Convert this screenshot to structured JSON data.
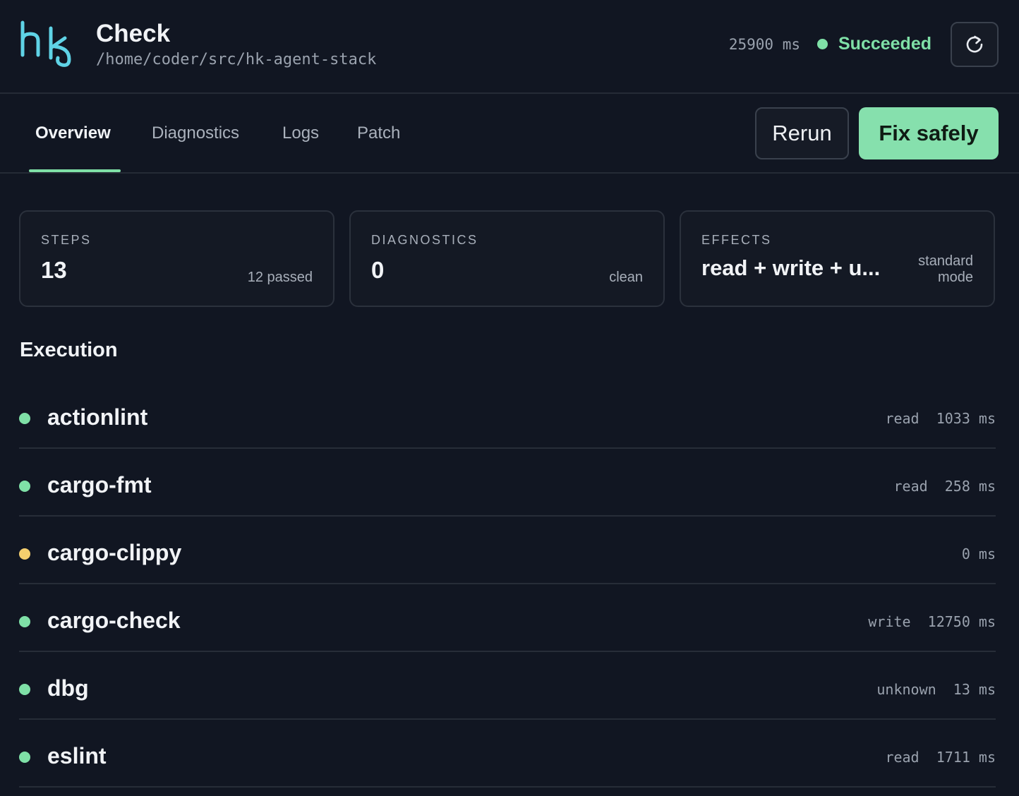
{
  "header": {
    "title": "Check",
    "path": "/home/coder/src/hk-agent-stack",
    "duration": "25900 ms",
    "status": "Succeeded",
    "status_color": "#7fe0a7",
    "refresh_icon": "refresh-icon"
  },
  "tabs": [
    {
      "label": "Overview",
      "active": true
    },
    {
      "label": "Diagnostics",
      "active": false
    },
    {
      "label": "Logs",
      "active": false
    },
    {
      "label": "Patch",
      "active": false
    }
  ],
  "actions": {
    "rerun_label": "Rerun",
    "fix_label": "Fix safely",
    "fix_color": "#86e0ad"
  },
  "cards": [
    {
      "label": "STEPS",
      "value": "13",
      "note": "12 passed"
    },
    {
      "label": "DIAGNOSTICS",
      "value": "0",
      "note": "clean"
    },
    {
      "label": "EFFECTS",
      "value": "read + write + u...",
      "note_line1": "standard",
      "note_line2": "mode"
    }
  ],
  "execution": {
    "title": "Execution",
    "steps": [
      {
        "name": "actionlint",
        "effect": "read",
        "time": "1033 ms",
        "status": "passed",
        "dot_color": "#7fe0a7"
      },
      {
        "name": "cargo-fmt",
        "effect": "read",
        "time": "258 ms",
        "status": "passed",
        "dot_color": "#7fe0a7"
      },
      {
        "name": "cargo-clippy",
        "effect": "",
        "time": "0 ms",
        "status": "pending",
        "dot_color": "#f5cf6e"
      },
      {
        "name": "cargo-check",
        "effect": "write",
        "time": "12750 ms",
        "status": "passed",
        "dot_color": "#7fe0a7"
      },
      {
        "name": "dbg",
        "effect": "unknown",
        "time": "13 ms",
        "status": "passed",
        "dot_color": "#7fe0a7"
      },
      {
        "name": "eslint",
        "effect": "read",
        "time": "1711 ms",
        "status": "passed",
        "dot_color": "#7fe0a7"
      }
    ]
  }
}
